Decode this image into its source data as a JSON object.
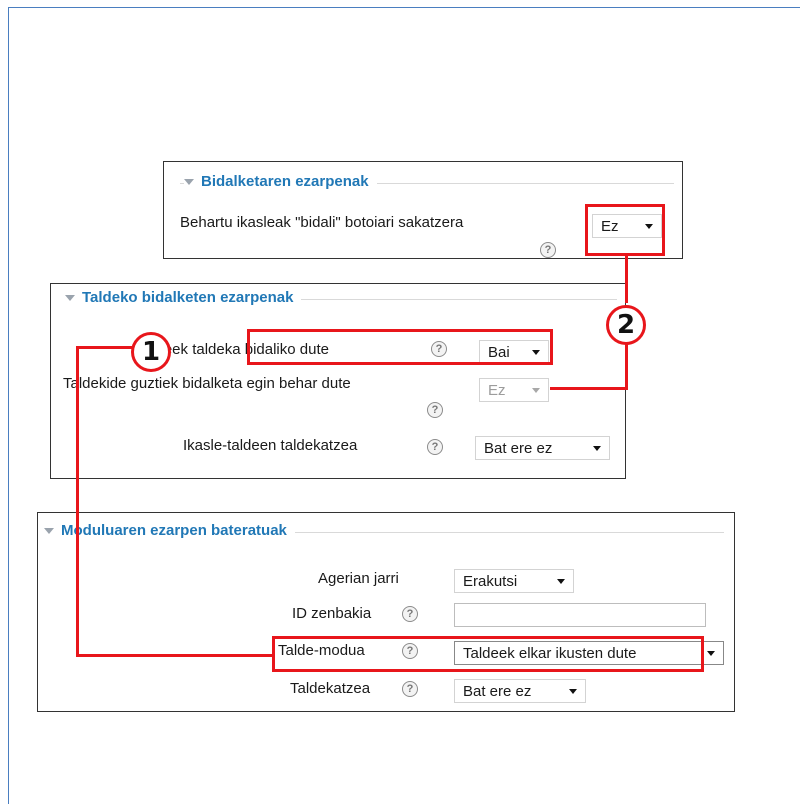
{
  "submission_settings": {
    "legend": "Bidalketaren ezarpenak",
    "require_submit_label": "Behartu ikasleak \"bidali\" botoiari sakatzera",
    "require_submit_value": "Ez"
  },
  "group_submission_settings": {
    "legend": "Taldeko bidalketen ezarpenak",
    "team_submission_label": "Ikasleek taldeka bidaliko dute",
    "team_submission_value": "Bai",
    "all_members_label": "Taldekide guztiek bidalketa egin behar dute",
    "all_members_value": "Ez",
    "grouping_label": "Ikasle-taldeen taldekatzea",
    "grouping_value": "Bat ere ez"
  },
  "common_module_settings": {
    "legend": "Moduluaren ezarpen bateratuak",
    "visible_label": "Agerian jarri",
    "visible_value": "Erakutsi",
    "idnumber_label": "ID zenbakia",
    "idnumber_value": "",
    "groupmode_label": "Talde-modua",
    "groupmode_value": "Taldeek elkar ikusten dute",
    "grouping_label": "Taldekatzea",
    "grouping_value": "Bat ere ez"
  },
  "annotations": {
    "badge_1": "1",
    "badge_2": "2"
  },
  "colors": {
    "legend_text": "#2178b6",
    "highlight_red": "#e8161b",
    "frame_border": "#4a7ec0"
  },
  "icons": {
    "help": "help-icon",
    "collapse": "collapse-triangle-icon",
    "dropdown": "chevron-down-icon"
  }
}
